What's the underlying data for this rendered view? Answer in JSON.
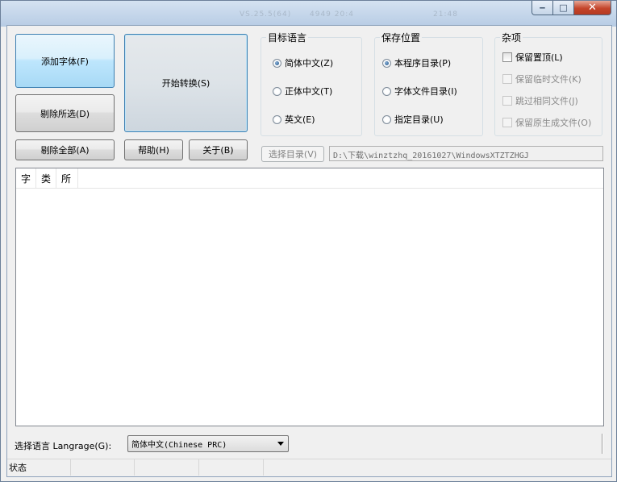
{
  "titlebar": {
    "ghost_1": "VS.25.5(64)",
    "ghost_2": "4949 20:4",
    "ghost_3": "21:48",
    "minimize_glyph": "‒",
    "maximize_glyph": "□",
    "close_glyph": "✕"
  },
  "buttons": {
    "add_font": "添加字体(F)",
    "start_convert": "开始转换(S)",
    "remove_selected": "剔除所选(D)",
    "remove_all": "剔除全部(A)",
    "help": "帮助(H)",
    "about": "关于(B)",
    "choose_dir": "选择目录(V)"
  },
  "target_language": {
    "title": "目标语言",
    "options": [
      {
        "label": "简体中文(Z)",
        "selected": true
      },
      {
        "label": "正体中文(T)",
        "selected": false
      },
      {
        "label": "英文(E)",
        "selected": false
      }
    ]
  },
  "save_location": {
    "title": "保存位置",
    "options": [
      {
        "label": "本程序目录(P)",
        "selected": true
      },
      {
        "label": "字体文件目录(I)",
        "selected": false
      },
      {
        "label": "指定目录(U)",
        "selected": false
      }
    ]
  },
  "misc": {
    "title": "杂项",
    "options": [
      {
        "label": "保留置顶(L)",
        "checked": false,
        "enabled": true
      },
      {
        "label": "保留临时文件(K)",
        "checked": false,
        "enabled": false
      },
      {
        "label": "跳过相同文件(J)",
        "checked": false,
        "enabled": false
      },
      {
        "label": "保留原生成文件(O)",
        "checked": false,
        "enabled": false
      }
    ]
  },
  "output_path": "D:\\下载\\winztzhq_20161027\\WindowsXTZTZHGJ",
  "listview": {
    "columns": [
      "字",
      "类",
      "所"
    ]
  },
  "language": {
    "label": "选择语言 Langrage(G):",
    "selected": "简体中文(Chinese PRC)"
  },
  "statusbar": {
    "status": "状态"
  },
  "colors": {
    "accent": "#3c7fb1",
    "close_red": "#c4452b"
  }
}
